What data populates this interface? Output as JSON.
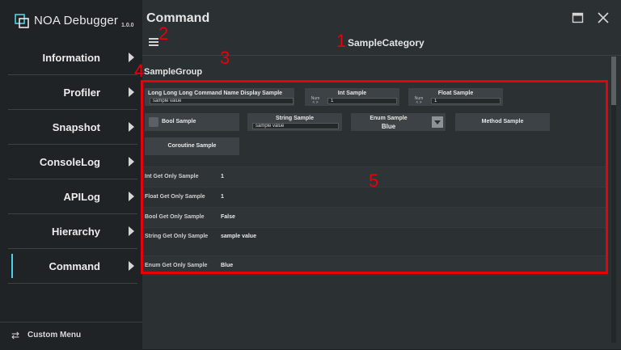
{
  "app": {
    "title": "NOA Debugger",
    "version": "1.0.0"
  },
  "sidebar": {
    "items": [
      {
        "label": "Information",
        "active": false
      },
      {
        "label": "Profiler",
        "active": false
      },
      {
        "label": "Snapshot",
        "active": false
      },
      {
        "label": "ConsoleLog",
        "active": false
      },
      {
        "label": "APILog",
        "active": false
      },
      {
        "label": "Hierarchy",
        "active": false
      },
      {
        "label": "Command",
        "active": true
      }
    ],
    "footer_label": "Custom Menu",
    "footer_icon": "swap-arrows-icon"
  },
  "main": {
    "title": "Command",
    "category": "SampleCategory",
    "group": "SampleGroup",
    "commands": {
      "long_name": {
        "title": "Long Long Long Command Name Display Sample",
        "value": "sample value"
      },
      "int": {
        "title": "Int Sample",
        "num_label": "Num",
        "arrows": "< >",
        "value": "1"
      },
      "float": {
        "title": "Float Sample",
        "num_label": "Num",
        "arrows": "< >",
        "value": "1"
      },
      "bool": {
        "title": "Bool Sample"
      },
      "string": {
        "title": "String Sample",
        "value": "sample value"
      },
      "enum": {
        "title": "Enum Sample",
        "value": "Blue"
      },
      "method": {
        "title": "Method Sample"
      },
      "coroutine": {
        "title": "Coroutine Sample"
      }
    },
    "get_only": [
      {
        "key": "Int Get Only Sample",
        "value": "1"
      },
      {
        "key": "Float Get Only Sample",
        "value": "1"
      },
      {
        "key": "Bool Get Only Sample",
        "value": "False"
      },
      {
        "key": "String Get Only Sample",
        "value": "sample value"
      },
      {
        "key": "Enum Get Only Sample",
        "value": "Blue"
      }
    ]
  },
  "annotations": [
    "1",
    "2",
    "3",
    "4",
    "5"
  ],
  "colors": {
    "accent": "#4fd0e6",
    "annotation": "#e8000b"
  }
}
